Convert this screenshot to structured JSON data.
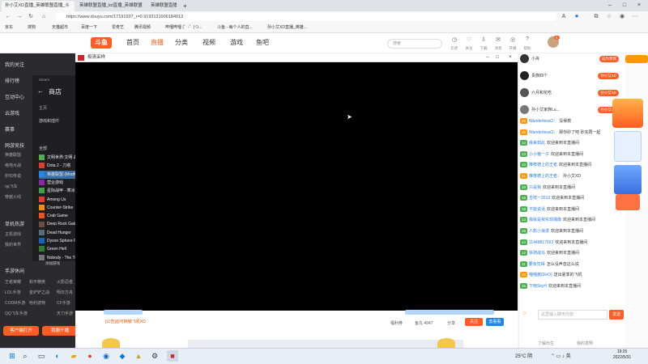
{
  "browser": {
    "tabs": [
      {
        "label": "孙小艾XD直播_英雄联盟直播_斗"
      },
      {
        "label": "英雄联盟直播_lol直播_英雄联盟"
      },
      {
        "label": "英雄联盟直播_英雄联盟视"
      }
    ],
    "new_tab": "+",
    "url": "https://www.douyu.com/17191937_r=0.9193131906184913",
    "bookmarks": [
      "京东",
      "搜狗",
      "天猫超市",
      "百度一下",
      "爱奇艺",
      "腾讯视频",
      "哔哩哔哩 (゜-゜)つ...",
      "斗鱼 - 每个人的直...",
      "孙小艾XD直播_英雄..."
    ]
  },
  "site": {
    "logo": "斗鱼",
    "nav": [
      "首页",
      "直播",
      "分类",
      "视频",
      "游戏",
      "鱼吧"
    ],
    "search_placeholder": "搜索",
    "header_icons": [
      "历史",
      "关注",
      "下载",
      "消息",
      "开播",
      "帮助"
    ],
    "badge_count": "4"
  },
  "sidebar": {
    "items": [
      "我的关注",
      "排行榜",
      "互动中心",
      "云游戏",
      "赛事",
      "网游竞技",
      "英雄联盟",
      "绝地大战",
      "炉石传说",
      "qq飞车",
      "穿越火线",
      "单机热游",
      "主机游戏",
      "我的世界",
      "手游休闲",
      "王者荣耀",
      "LOL手游",
      "CODM手游",
      "原神",
      "QQ飞车手游"
    ],
    "sub_items": [
      "和平精英",
      "火影忍者",
      "金铲铲之战",
      "明日方舟",
      "哈利波特",
      "CF手游",
      "天刀手游"
    ],
    "btn_live": "客户端打开",
    "btn_open": "我要开播"
  },
  "store": {
    "title": "商店",
    "nav_back": "Steam",
    "library": "游戏和插件",
    "search": "全部",
    "games": [
      {
        "name": "文明世界:文明 战争",
        "color": "#4caf50"
      },
      {
        "name": "Dota 2 - 刀塔",
        "color": "#e53935"
      },
      {
        "name": "英雄联盟 (ModIO)",
        "color": "#1e88e5"
      },
      {
        "name": "营业游戏",
        "color": "#8e24aa"
      },
      {
        "name": "星际战甲 · 寒冰",
        "color": "#43a047"
      },
      {
        "name": "Among Us",
        "color": "#e53935"
      },
      {
        "name": "Counter-Strike",
        "color": "#fb8c00"
      },
      {
        "name": "Crab Game",
        "color": "#f4511e"
      },
      {
        "name": "Deep Rock Galactic",
        "color": "#6d4c41"
      },
      {
        "name": "Dead Hunger",
        "color": "#546e7a"
      },
      {
        "name": "Dyson Sphere Program",
        "color": "#1565c0"
      },
      {
        "name": "Green Hell",
        "color": "#2e7d32"
      },
      {
        "name": "Nobody - The Turnaround",
        "color": "#757575"
      }
    ],
    "add_game": "添加游戏"
  },
  "player": {
    "title": "极清采样",
    "bottom_left": "[公告]@可撕敏飞机XD",
    "bottom_items": [
      "福利券",
      "鱼丸 4947",
      "分享",
      "去看看"
    ],
    "follow": "关注"
  },
  "chat": {
    "ranks": [
      {
        "name": "小舟",
        "tag": "成为贵宾"
      },
      {
        "name": "贵族四个",
        "tag": "孙小艾XD"
      },
      {
        "name": "六月和花吃",
        "tag": "孙小艾XD"
      },
      {
        "name": "孙小艾家族Lu...",
        "tag": "孙小艾XD"
      }
    ],
    "messages": [
      {
        "lvl": "26",
        "color": "#ff9800",
        "user": "WanderlessO：",
        "text": "没得救"
      },
      {
        "lvl": "26",
        "color": "#ff9800",
        "user": "WanderlessO：",
        "text": "那你砂了吧 砂完再一起"
      },
      {
        "lvl": "14",
        "color": "#4caf50",
        "user": "缘来如此",
        "text": "欢迎来到本直播间"
      },
      {
        "lvl": "13",
        "color": "#4caf50",
        "user": "小小猪一子",
        "text": "欢迎来到本直播间"
      },
      {
        "lvl": "12",
        "color": "#4caf50",
        "user": "推荐德上的王者",
        "text": "欢迎来到本直播间"
      },
      {
        "lvl": "21",
        "color": "#ff9800",
        "user": "推荐德上的王者：",
        "text": "孙小艾XD"
      },
      {
        "lvl": "10",
        "color": "#4caf50",
        "user": "只是我",
        "text": "欢迎来到本直播间"
      },
      {
        "lvl": "15",
        "color": "#4caf50",
        "user": "吉祥一2013",
        "text": "欢迎来到本直播间"
      },
      {
        "lvl": "18",
        "color": "#4caf50",
        "user": "不能说话",
        "text": "欢迎来到本直播间"
      },
      {
        "lvl": "13",
        "color": "#4caf50",
        "user": "我就是我实现偶像",
        "text": "欢迎来到本直播间"
      },
      {
        "lvl": "16",
        "color": "#4caf50",
        "user": "人影小浪漫",
        "text": "欢迎来到本直播间"
      },
      {
        "lvl": "14",
        "color": "#4caf50",
        "user": "11449817593",
        "text": "欢迎来到本直播间"
      },
      {
        "lvl": "12",
        "color": "#4caf50",
        "user": "铁骑战马",
        "text": "欢迎来到本直播间"
      },
      {
        "lvl": "11",
        "color": "#4caf50",
        "user": "要有觉得",
        "text": "怎么没声音这么说"
      },
      {
        "lvl": "26",
        "color": "#ff9800",
        "user": "喵喵酱(DeO)",
        "text": "送出夏季的飞机"
      },
      {
        "lvl": "15",
        "color": "#4caf50",
        "user": "下雨SkyH",
        "text": "欢迎来到本直播间"
      }
    ],
    "input_placeholder": "这里输入聊天内容",
    "send": "发送",
    "footer_left": "了解出生",
    "footer_right": "我的发明"
  },
  "taskbar": {
    "weather": "25°C 阴",
    "time": "19:25",
    "date": "2022/5/31"
  }
}
